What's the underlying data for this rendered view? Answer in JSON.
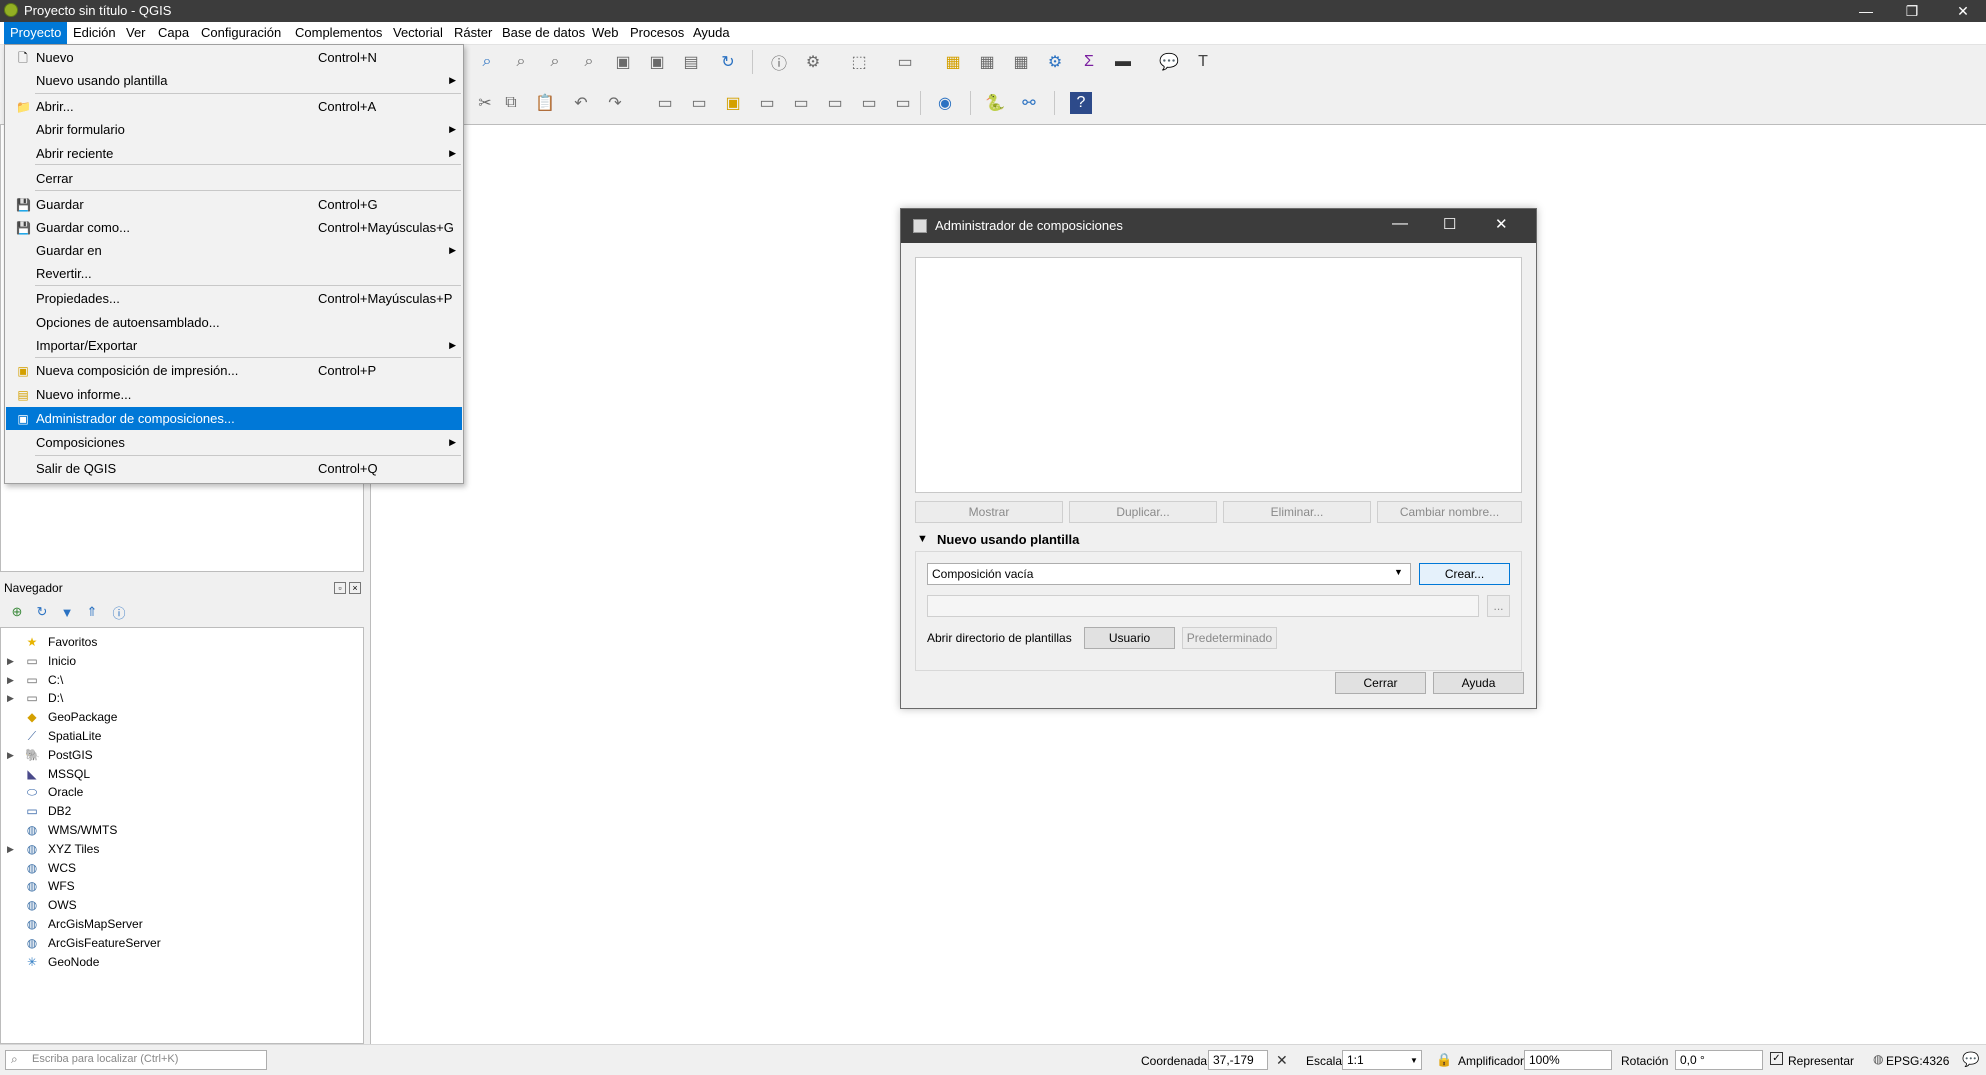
{
  "window": {
    "title": "Proyecto sin título - QGIS",
    "minimize": "—",
    "restore": "❐",
    "close": "✕"
  },
  "menubar": [
    "Proyecto",
    "Edición",
    "Ver",
    "Capa",
    "Configuración",
    "Complementos",
    "Vectorial",
    "Ráster",
    "Base de datos",
    "Web",
    "Procesos",
    "Ayuda"
  ],
  "project_menu": [
    {
      "label": "Nuevo",
      "shortcut": "Control+N",
      "icon": "new-file-icon",
      "sub": false
    },
    {
      "label": "Nuevo usando plantilla",
      "shortcut": "",
      "icon": "",
      "sub": true
    },
    {
      "label": "Abrir...",
      "shortcut": "Control+A",
      "icon": "folder-icon",
      "sub": false
    },
    {
      "label": "Abrir formulario",
      "shortcut": "",
      "icon": "",
      "sub": true
    },
    {
      "label": "Abrir reciente",
      "shortcut": "",
      "icon": "",
      "sub": true
    },
    {
      "label": "Cerrar",
      "shortcut": "",
      "icon": "",
      "sub": false
    },
    {
      "label": "Guardar",
      "shortcut": "Control+G",
      "icon": "save-icon",
      "sub": false
    },
    {
      "label": "Guardar como...",
      "shortcut": "Control+Mayúsculas+G",
      "icon": "save-as-icon",
      "sub": false
    },
    {
      "label": "Guardar en",
      "shortcut": "",
      "icon": "",
      "sub": true
    },
    {
      "label": "Revertir...",
      "shortcut": "",
      "icon": "",
      "sub": false
    },
    {
      "label": "Propiedades...",
      "shortcut": "Control+Mayúsculas+P",
      "icon": "",
      "sub": false
    },
    {
      "label": "Opciones de autoensamblado...",
      "shortcut": "",
      "icon": "",
      "sub": false
    },
    {
      "label": "Importar/Exportar",
      "shortcut": "",
      "icon": "",
      "sub": true
    },
    {
      "label": "Nueva composición de impresión...",
      "shortcut": "Control+P",
      "icon": "new-layout-icon",
      "sub": false
    },
    {
      "label": "Nuevo informe...",
      "shortcut": "",
      "icon": "new-report-icon",
      "sub": false
    },
    {
      "label": "Administrador de composiciones...",
      "shortcut": "",
      "icon": "layout-manager-icon",
      "sub": false
    },
    {
      "label": "Composiciones",
      "shortcut": "",
      "icon": "",
      "sub": true
    },
    {
      "label": "Salir de QGIS",
      "shortcut": "Control+Q",
      "icon": "",
      "sub": false
    }
  ],
  "navigator": {
    "title": "Navegador",
    "items": [
      {
        "label": "Favoritos",
        "icon": "star-icon",
        "expandable": false
      },
      {
        "label": "Inicio",
        "icon": "folder-icon",
        "expandable": true
      },
      {
        "label": "C:\\",
        "icon": "folder-icon",
        "expandable": true
      },
      {
        "label": "D:\\",
        "icon": "folder-icon",
        "expandable": true
      },
      {
        "label": "GeoPackage",
        "icon": "geopackage-icon",
        "expandable": false
      },
      {
        "label": "SpatiaLite",
        "icon": "spatialite-icon",
        "expandable": false
      },
      {
        "label": "PostGIS",
        "icon": "postgis-icon",
        "expandable": true
      },
      {
        "label": "MSSQL",
        "icon": "mssql-icon",
        "expandable": false
      },
      {
        "label": "Oracle",
        "icon": "oracle-icon",
        "expandable": false
      },
      {
        "label": "DB2",
        "icon": "db2-icon",
        "expandable": false
      },
      {
        "label": "WMS/WMTS",
        "icon": "globe-icon",
        "expandable": false
      },
      {
        "label": "XYZ Tiles",
        "icon": "globe-icon",
        "expandable": true
      },
      {
        "label": "WCS",
        "icon": "globe-icon",
        "expandable": false
      },
      {
        "label": "WFS",
        "icon": "globe-icon",
        "expandable": false
      },
      {
        "label": "OWS",
        "icon": "globe-icon",
        "expandable": false
      },
      {
        "label": "ArcGisMapServer",
        "icon": "globe-icon",
        "expandable": false
      },
      {
        "label": "ArcGisFeatureServer",
        "icon": "globe-icon",
        "expandable": false
      },
      {
        "label": "GeoNode",
        "icon": "geonode-icon",
        "expandable": false
      }
    ]
  },
  "dialog": {
    "title": "Administrador de composiciones",
    "buttons": {
      "show": "Mostrar",
      "duplicate": "Duplicar...",
      "remove": "Eliminar...",
      "rename": "Cambiar nombre..."
    },
    "template_section": "Nuevo usando plantilla",
    "template_select": "Composición vacía",
    "create": "Crear...",
    "browse": "...",
    "open_dir_label": "Abrir directorio de plantillas",
    "user": "Usuario",
    "default": "Predeterminado",
    "close": "Cerrar",
    "help": "Ayuda"
  },
  "statusbar": {
    "search_placeholder": "Escriba para localizar (Ctrl+K)",
    "coord_label": "Coordenada",
    "coord_value": "37,-179",
    "scale_label": "Escala",
    "scale_value": "1:1",
    "magnifier_label": "Amplificador",
    "magnifier_value": "100%",
    "rotation_label": "Rotación",
    "rotation_value": "0,0 °",
    "render_label": "Representar",
    "crs": "EPSG:4326"
  }
}
